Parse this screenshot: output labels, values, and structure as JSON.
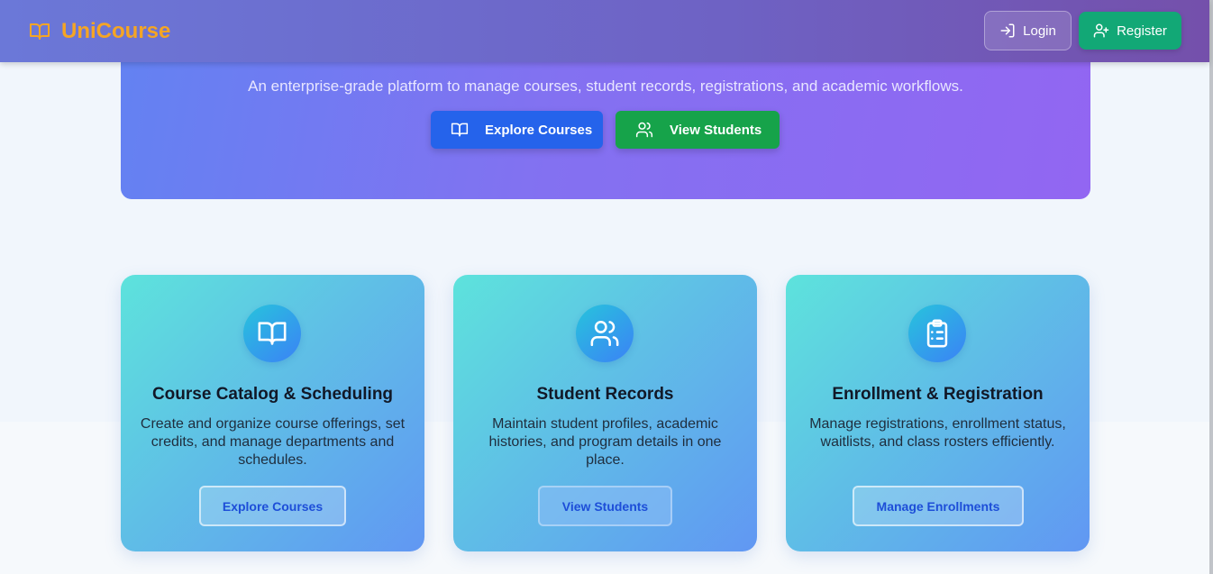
{
  "header": {
    "brand": "UniCourse",
    "login_label": "Login",
    "register_label": "Register"
  },
  "hero": {
    "subtitle": "An enterprise-grade platform to manage courses, student records, registrations, and academic workflows.",
    "explore_label": "Explore Courses",
    "students_label": "View Students"
  },
  "cards": [
    {
      "icon": "book-open-icon",
      "title": "Course Catalog & Scheduling",
      "description": "Create and organize course offerings, set credits, and manage departments and schedules.",
      "button": "Explore Courses"
    },
    {
      "icon": "users-icon",
      "title": "Student Records",
      "description": "Maintain student profiles, academic histories, and program details in one place.",
      "button": "View Students"
    },
    {
      "icon": "clipboard-list-icon",
      "title": "Enrollment & Registration",
      "description": "Manage registrations, enrollment status, waitlists, and class rosters efficiently.",
      "button": "Manage Enrollments"
    }
  ],
  "colors": {
    "brand": "#f5a524",
    "primary": "#2563eb",
    "success": "#16a34a",
    "register": "#12a876"
  }
}
